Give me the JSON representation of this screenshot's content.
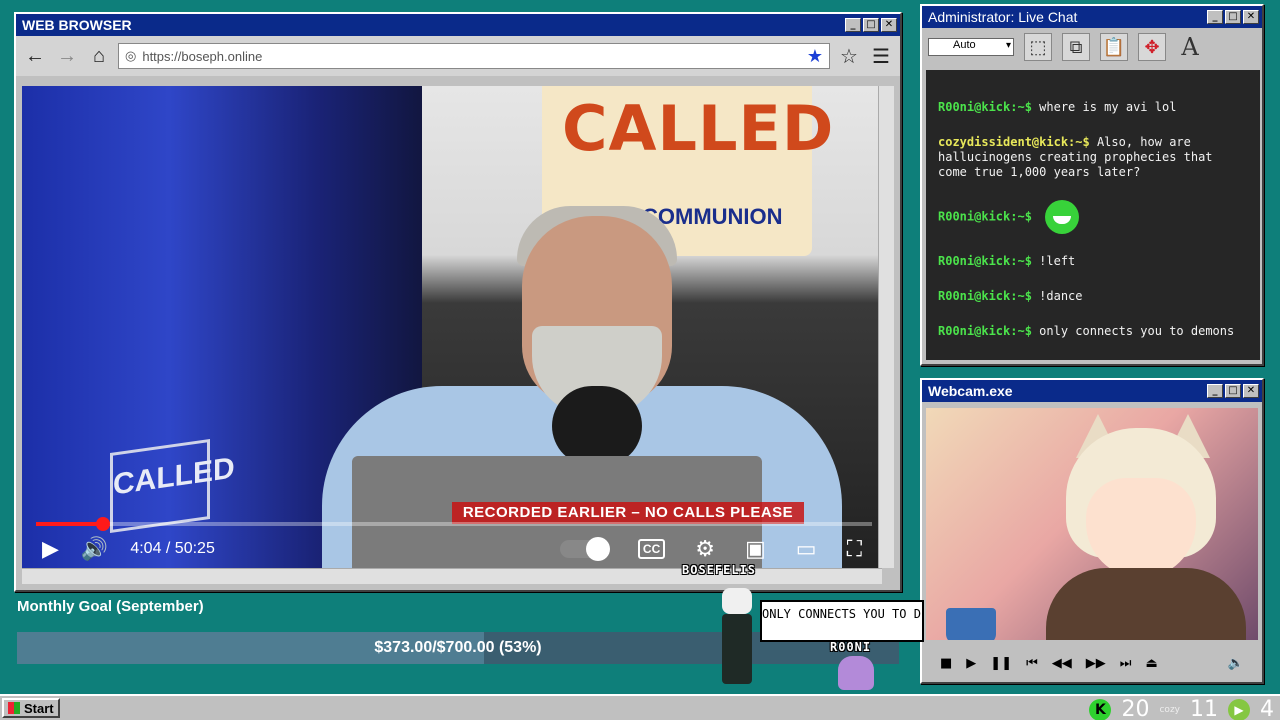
{
  "browser": {
    "title": "WEB BROWSER",
    "url": "https://boseph.online",
    "video": {
      "sign_text": "CALLED",
      "sign_subtext": "COMMUNION",
      "logo_text": "CALLED",
      "overlay_text": "RECORDED EARLIER  –  NO CALLS PLEASE",
      "time": "4:04 / 50:25",
      "progress": 0.08,
      "cc_label": "CC"
    }
  },
  "chat": {
    "title": "Administrator: Live Chat",
    "font_select": "Auto",
    "messages": [
      {
        "user": "R00ni@kick:~$",
        "text": "where is my avi lol",
        "color": "green"
      },
      {
        "user": "cozydissident@kick:~$",
        "text": "Also, how are hallucinogens creating prophecies that come true 1,000 years later?",
        "color": "yellow"
      },
      {
        "user": "R00ni@kick:~$",
        "text": "",
        "color": "green",
        "emote": true
      },
      {
        "user": "R00ni@kick:~$",
        "text": "!left",
        "color": "green"
      },
      {
        "user": "R00ni@kick:~$",
        "text": "!dance",
        "color": "green"
      },
      {
        "user": "R00ni@kick:~$",
        "text": "only connects you to demons",
        "color": "green"
      }
    ]
  },
  "webcam": {
    "title": "Webcam.exe"
  },
  "goal": {
    "title": "Monthly Goal (September)",
    "text": "$373.00/$700.00 (53%)",
    "progress": 0.53
  },
  "avatars": {
    "name1": "BOSEFELIS",
    "speech": "ONLY CONNECTS YOU TO DEMONS",
    "name2": "R00NI"
  },
  "taskbar": {
    "start_label": "Start",
    "count1": "20",
    "count2": "11",
    "count3": "4",
    "kick_label": "K",
    "cozy_label": "cozy"
  },
  "colors": {
    "desktop": "#0e7f7a",
    "titlebar": "#0a2a8a",
    "accent_red": "#ff1a1a",
    "chat_green": "#4be34b"
  }
}
